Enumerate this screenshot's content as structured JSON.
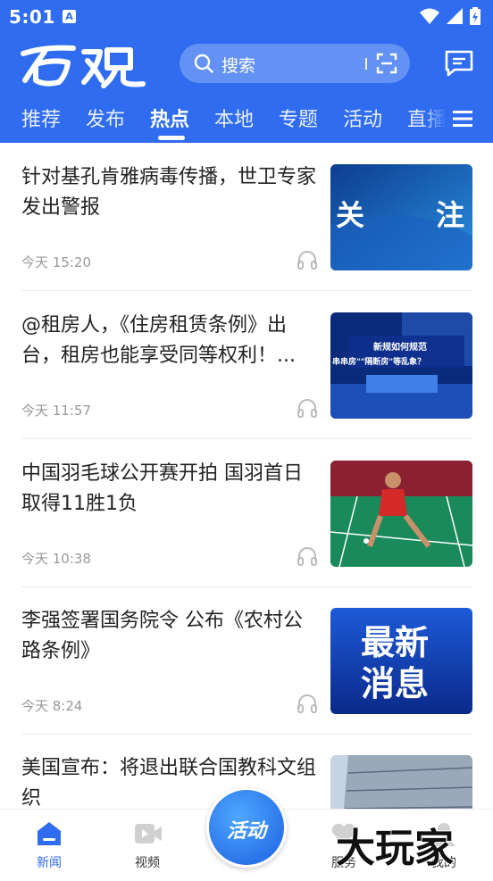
{
  "status": {
    "time": "5:01",
    "notif_badge": "A"
  },
  "header": {
    "logo": "百观",
    "search_placeholder": "搜索",
    "tabs": [
      {
        "label": "推荐"
      },
      {
        "label": "发布"
      },
      {
        "label": "热点",
        "active": true
      },
      {
        "label": "本地"
      },
      {
        "label": "专题"
      },
      {
        "label": "活动"
      },
      {
        "label": "直播"
      }
    ]
  },
  "feed": [
    {
      "title": "针对基孔肯雅病毒传播，世卫专家发出警报",
      "time": "今天 15:20",
      "thumb_text": [
        "关",
        "注"
      ]
    },
    {
      "title": "@租房人，《住房租赁条例》出台，租房也能享受同等权利！...",
      "time": "今天 11:57",
      "thumb_text": [
        "新规如何规范",
        "串串房\"\"隔断房\"等乱象？"
      ]
    },
    {
      "title": "中国羽毛球公开赛开拍 国羽首日取得11胜1负",
      "time": "今天 10:38"
    },
    {
      "title": "李强签署国务院令 公布《农村公路条例》",
      "time": "今天 8:24",
      "thumb_text": [
        "最新",
        "消息"
      ]
    },
    {
      "title": "美国宣布：将退出联合国教科文组织"
    }
  ],
  "bottom_nav": [
    {
      "label": "新闻",
      "icon": "news-icon",
      "active": true
    },
    {
      "label": "视频",
      "icon": "video-icon"
    },
    {
      "label": "活动",
      "icon": "activity-center-button"
    },
    {
      "label": "服务",
      "icon": "heart-icon"
    },
    {
      "label": "我的",
      "icon": "user-icon"
    }
  ],
  "watermark": "大玩家",
  "colors": {
    "brand": "#2f6cf0",
    "text": "#222222",
    "meta": "#999999"
  }
}
